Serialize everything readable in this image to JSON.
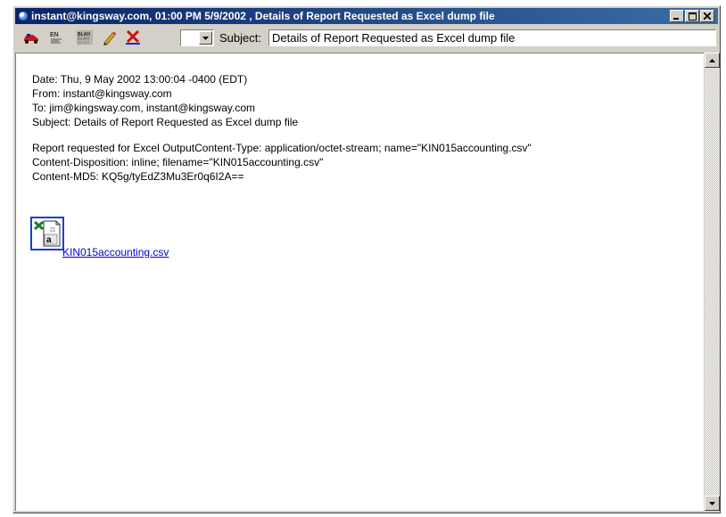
{
  "window": {
    "title": "instant@kingsway.com, 01:00 PM 5/9/2002 , Details of Report Requested as Excel dump file",
    "controls": {
      "minimize": "_",
      "maximize": "□",
      "close": "×"
    }
  },
  "toolbar": {
    "icons": [
      "car-icon",
      "eudora-code-icon",
      "blah-blah-icon",
      "pencil-icon",
      "delete-x-icon"
    ],
    "combo_value": "",
    "subject_label": "Subject:",
    "subject_value": "Details of Report Requested as Excel dump file"
  },
  "message": {
    "headers": [
      "Date: Thu, 9 May 2002 13:00:04 -0400 (EDT)",
      "From: instant@kingsway.com",
      "To: jim@kingsway.com, instant@kingsway.com",
      "Subject: Details of Report Requested as Excel dump file"
    ],
    "body": [
      "Report requested for Excel OutputContent-Type: application/octet-stream; name=\"KIN015accounting.csv\"",
      "Content-Disposition: inline; filename=\"KIN015accounting.csv\"",
      "Content-MD5: KQ5g/tyEdZ3Mu3Er0q6I2A=="
    ],
    "attachment": {
      "filename": " KIN015accounting.csv",
      "icon": "excel-file-icon"
    }
  },
  "colors": {
    "titlebar_start": "#0a246a",
    "titlebar_end": "#3a6ea5",
    "link": "#0000cc",
    "chrome": "#d4d0c8"
  }
}
